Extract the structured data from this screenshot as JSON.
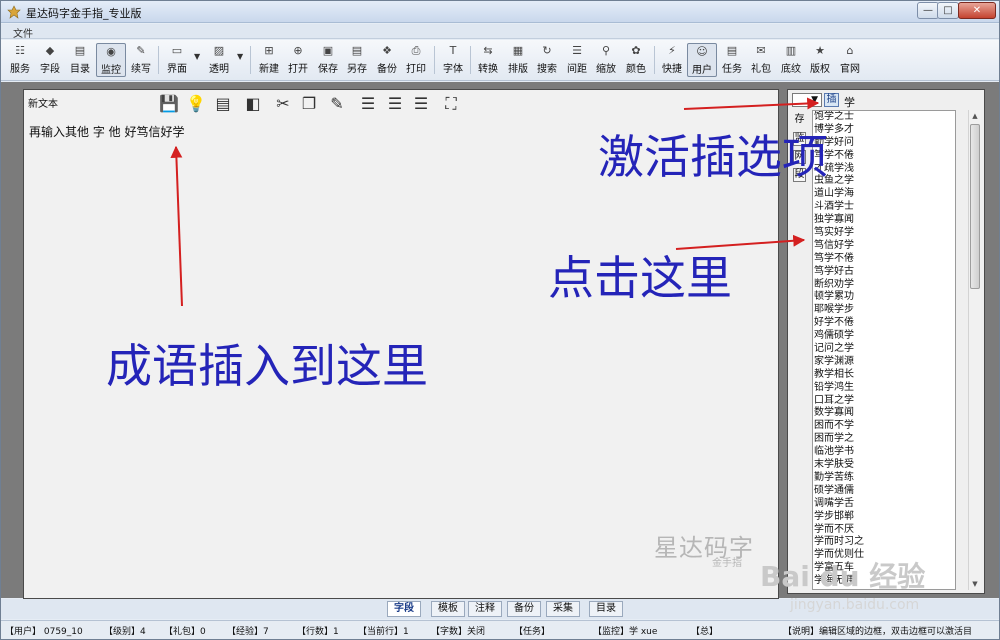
{
  "window": {
    "title": "星达码字金手指_专业版",
    "minimize": "—",
    "maximize": "□",
    "close": "✕"
  },
  "menu": {
    "file": "文件"
  },
  "toolbar": {
    "service": "服务",
    "field": "字段",
    "catalog": "目录",
    "monitor": "监控",
    "continue": "续写",
    "interface": "界面",
    "transparent": "透明",
    "new": "新建",
    "open": "打开",
    "save": "保存",
    "save_as": "另存",
    "backup": "备份",
    "print": "打印",
    "font": "字体",
    "convert": "转换",
    "layout": "排版",
    "search": "搜索",
    "spacing": "间距",
    "zoom": "缩放",
    "color": "颜色",
    "shortcut": "快捷",
    "user": "用户",
    "task": "任务",
    "gift": "礼包",
    "bottom": "底纹",
    "copyright": "版权",
    "official": "官网"
  },
  "editor": {
    "title": "新文本",
    "content": "再输入其他 字 他 好笃信好学",
    "watermark_main": "星达码字",
    "watermark_sub": "金手指"
  },
  "idiom_panel": {
    "insert_label": "插",
    "char": "学",
    "side_save": "存",
    "side_a": "监",
    "side_b": "网",
    "side_c": "段",
    "items": [
      "饱学之士",
      "博学多才",
      "勤学好问",
      "笃学不倦",
      "才疏学浅",
      "虫鱼之学",
      "道山学海",
      "斗酒学士",
      "独学寡闻",
      "笃实好学",
      "笃信好学",
      "笃学不倦",
      "笃学好古",
      "断织劝学",
      "顿学累功",
      "耶喉学步",
      "好学不倦",
      "鸡儒硕学",
      "记问之学",
      "家学渊源",
      "教学相长",
      "铅学鸿生",
      "口耳之学",
      "数学寡闻",
      "困而不学",
      "困而学之",
      "临池学书",
      "末学肤受",
      "勤学苦练",
      "硕学通儒",
      "调嘴学舌",
      "学步邯郸",
      "学而不厌",
      "学而时习之",
      "学而优则仕",
      "学富五车",
      "学海无涯"
    ]
  },
  "tabs": [
    "字段",
    "模板",
    "注释",
    "备份",
    "采集",
    "目录"
  ],
  "status": {
    "user": "【用户】 0759_10",
    "level": "【级别】4",
    "gift": "【礼包】0",
    "exp": "【经验】7",
    "lines": "【行数】1",
    "current_line": "【当前行】1",
    "word_count": "【字数】关闭",
    "task": "【任务】",
    "monitor": "【监控】学 xue",
    "total": "【总】",
    "hint": "【说明】编辑区域的边框，双击边框可以激活目"
  },
  "annotations": {
    "activate": "激活插选项",
    "click_here": "点击这里",
    "inserted_here": "成语插入到这里",
    "arrow_color": "#d42020",
    "text_color": "#2424b8"
  },
  "watermark_site": {
    "brand": "Bai du 经验",
    "url": "jingyan.baidu.com"
  }
}
